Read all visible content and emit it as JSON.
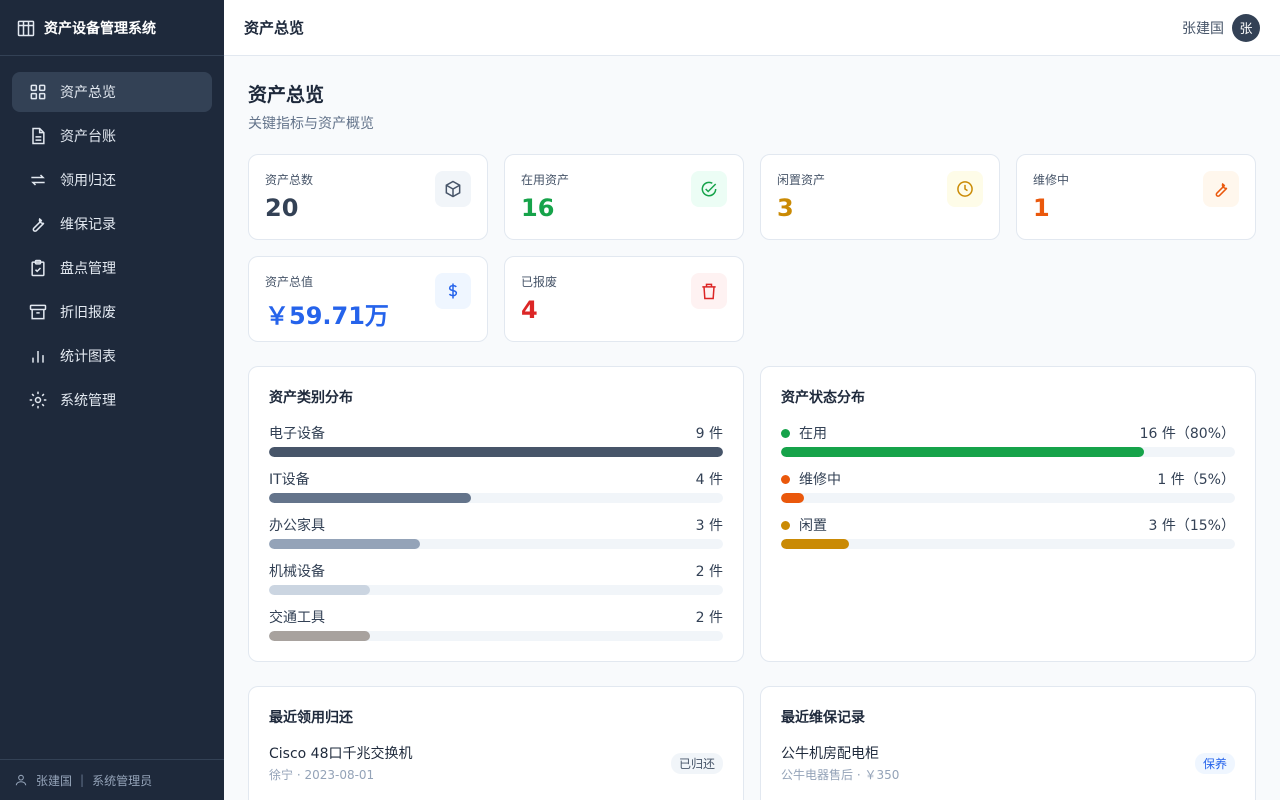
{
  "app": {
    "title": "资产设备管理系统"
  },
  "sidebar": {
    "items": [
      {
        "label": "资产总览",
        "icon": "grid-icon",
        "active": true
      },
      {
        "label": "资产台账",
        "icon": "document-icon"
      },
      {
        "label": "领用归还",
        "icon": "swap-icon"
      },
      {
        "label": "维保记录",
        "icon": "wrench-icon"
      },
      {
        "label": "盘点管理",
        "icon": "clipboard-check-icon"
      },
      {
        "label": "折旧报废",
        "icon": "archive-icon"
      },
      {
        "label": "统计图表",
        "icon": "bar-chart-icon"
      },
      {
        "label": "系统管理",
        "icon": "gear-icon"
      }
    ],
    "footer": {
      "user": "张建国",
      "separator": "|",
      "role": "系统管理员"
    }
  },
  "header": {
    "title": "资产总览",
    "user_name": "张建国",
    "avatar_text": "张"
  },
  "main": {
    "title": "资产总览",
    "subtitle": "关键指标与资产概览",
    "stats": [
      {
        "label": "资产总数",
        "value": "20",
        "color": "#334155",
        "icon": "box-icon",
        "icon_bg": "#f1f5f9"
      },
      {
        "label": "在用资产",
        "value": "16",
        "color": "#16a34a",
        "icon": "check-circle-icon",
        "icon_bg": "#ecfdf5"
      },
      {
        "label": "闲置资产",
        "value": "3",
        "color": "#ca8a04",
        "icon": "clock-icon",
        "icon_bg": "#fefce8"
      },
      {
        "label": "维修中",
        "value": "1",
        "color": "#ea580c",
        "icon": "wrench-icon",
        "icon_bg": "#fff7ed"
      },
      {
        "label": "资产总值",
        "value": "￥59.71万",
        "color": "#2563eb",
        "icon": "dollar-icon",
        "icon_bg": "#eff6ff"
      },
      {
        "label": "已报废",
        "value": "4",
        "color": "#dc2626",
        "icon": "trash-icon",
        "icon_bg": "#fef2f2"
      }
    ],
    "category": {
      "title": "资产类别分布",
      "items": [
        {
          "label": "电子设备",
          "count": "9 件",
          "value": 9,
          "color": "#475569"
        },
        {
          "label": "IT设备",
          "count": "4 件",
          "value": 4,
          "color": "#64748b"
        },
        {
          "label": "办公家具",
          "count": "3 件",
          "value": 3,
          "color": "#94a3b8"
        },
        {
          "label": "机械设备",
          "count": "2 件",
          "value": 2,
          "color": "#cbd5e1"
        },
        {
          "label": "交通工具",
          "count": "2 件",
          "value": 2,
          "color": "#a8a29e"
        }
      ],
      "max": 9
    },
    "status": {
      "title": "资产状态分布",
      "items": [
        {
          "label": "在用",
          "count": "16 件（80%）",
          "percent": 80,
          "color": "#16a34a"
        },
        {
          "label": "维修中",
          "count": "1 件（5%）",
          "percent": 5,
          "color": "#ea580c"
        },
        {
          "label": "闲置",
          "count": "3 件（15%）",
          "percent": 15,
          "color": "#ca8a04"
        }
      ]
    },
    "recent_loans": {
      "title": "最近领用归还",
      "items": [
        {
          "title": "Cisco 48口千兆交换机",
          "sub": "徐宁 · 2023-08-01",
          "badge": "已归还",
          "badge_color": "#475569",
          "badge_bg": "#f1f5f9"
        }
      ]
    },
    "recent_maintenance": {
      "title": "最近维保记录",
      "items": [
        {
          "title": "公牛机房配电柜",
          "sub": "公牛电器售后 · ￥350",
          "badge": "保养",
          "badge_color": "#2563eb",
          "badge_bg": "#eff6ff"
        }
      ]
    }
  }
}
